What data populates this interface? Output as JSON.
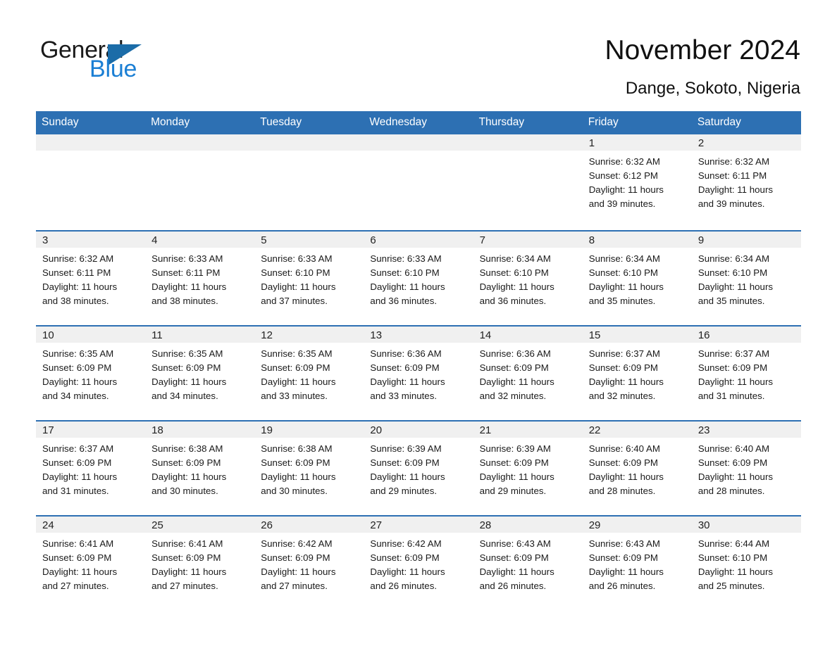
{
  "brand": {
    "name_part1": "General",
    "name_part2": "Blue",
    "triangle_color": "#1b6ca8",
    "blue_color": "#1b7fd4"
  },
  "header": {
    "title": "November 2024",
    "subtitle": "Dange, Sokoto, Nigeria"
  },
  "theme": {
    "header_bg": "#2d70b3",
    "header_text": "#ffffff",
    "daynum_bg": "#f0f0f0",
    "row_divider": "#2d70b3"
  },
  "weekdays": [
    "Sunday",
    "Monday",
    "Tuesday",
    "Wednesday",
    "Thursday",
    "Friday",
    "Saturday"
  ],
  "weeks": [
    [
      {
        "day": "",
        "sunrise": "",
        "sunset": "",
        "daylight_1": "",
        "daylight_2": ""
      },
      {
        "day": "",
        "sunrise": "",
        "sunset": "",
        "daylight_1": "",
        "daylight_2": ""
      },
      {
        "day": "",
        "sunrise": "",
        "sunset": "",
        "daylight_1": "",
        "daylight_2": ""
      },
      {
        "day": "",
        "sunrise": "",
        "sunset": "",
        "daylight_1": "",
        "daylight_2": ""
      },
      {
        "day": "",
        "sunrise": "",
        "sunset": "",
        "daylight_1": "",
        "daylight_2": ""
      },
      {
        "day": "1",
        "sunrise": "Sunrise: 6:32 AM",
        "sunset": "Sunset: 6:12 PM",
        "daylight_1": "Daylight: 11 hours",
        "daylight_2": "and 39 minutes."
      },
      {
        "day": "2",
        "sunrise": "Sunrise: 6:32 AM",
        "sunset": "Sunset: 6:11 PM",
        "daylight_1": "Daylight: 11 hours",
        "daylight_2": "and 39 minutes."
      }
    ],
    [
      {
        "day": "3",
        "sunrise": "Sunrise: 6:32 AM",
        "sunset": "Sunset: 6:11 PM",
        "daylight_1": "Daylight: 11 hours",
        "daylight_2": "and 38 minutes."
      },
      {
        "day": "4",
        "sunrise": "Sunrise: 6:33 AM",
        "sunset": "Sunset: 6:11 PM",
        "daylight_1": "Daylight: 11 hours",
        "daylight_2": "and 38 minutes."
      },
      {
        "day": "5",
        "sunrise": "Sunrise: 6:33 AM",
        "sunset": "Sunset: 6:10 PM",
        "daylight_1": "Daylight: 11 hours",
        "daylight_2": "and 37 minutes."
      },
      {
        "day": "6",
        "sunrise": "Sunrise: 6:33 AM",
        "sunset": "Sunset: 6:10 PM",
        "daylight_1": "Daylight: 11 hours",
        "daylight_2": "and 36 minutes."
      },
      {
        "day": "7",
        "sunrise": "Sunrise: 6:34 AM",
        "sunset": "Sunset: 6:10 PM",
        "daylight_1": "Daylight: 11 hours",
        "daylight_2": "and 36 minutes."
      },
      {
        "day": "8",
        "sunrise": "Sunrise: 6:34 AM",
        "sunset": "Sunset: 6:10 PM",
        "daylight_1": "Daylight: 11 hours",
        "daylight_2": "and 35 minutes."
      },
      {
        "day": "9",
        "sunrise": "Sunrise: 6:34 AM",
        "sunset": "Sunset: 6:10 PM",
        "daylight_1": "Daylight: 11 hours",
        "daylight_2": "and 35 minutes."
      }
    ],
    [
      {
        "day": "10",
        "sunrise": "Sunrise: 6:35 AM",
        "sunset": "Sunset: 6:09 PM",
        "daylight_1": "Daylight: 11 hours",
        "daylight_2": "and 34 minutes."
      },
      {
        "day": "11",
        "sunrise": "Sunrise: 6:35 AM",
        "sunset": "Sunset: 6:09 PM",
        "daylight_1": "Daylight: 11 hours",
        "daylight_2": "and 34 minutes."
      },
      {
        "day": "12",
        "sunrise": "Sunrise: 6:35 AM",
        "sunset": "Sunset: 6:09 PM",
        "daylight_1": "Daylight: 11 hours",
        "daylight_2": "and 33 minutes."
      },
      {
        "day": "13",
        "sunrise": "Sunrise: 6:36 AM",
        "sunset": "Sunset: 6:09 PM",
        "daylight_1": "Daylight: 11 hours",
        "daylight_2": "and 33 minutes."
      },
      {
        "day": "14",
        "sunrise": "Sunrise: 6:36 AM",
        "sunset": "Sunset: 6:09 PM",
        "daylight_1": "Daylight: 11 hours",
        "daylight_2": "and 32 minutes."
      },
      {
        "day": "15",
        "sunrise": "Sunrise: 6:37 AM",
        "sunset": "Sunset: 6:09 PM",
        "daylight_1": "Daylight: 11 hours",
        "daylight_2": "and 32 minutes."
      },
      {
        "day": "16",
        "sunrise": "Sunrise: 6:37 AM",
        "sunset": "Sunset: 6:09 PM",
        "daylight_1": "Daylight: 11 hours",
        "daylight_2": "and 31 minutes."
      }
    ],
    [
      {
        "day": "17",
        "sunrise": "Sunrise: 6:37 AM",
        "sunset": "Sunset: 6:09 PM",
        "daylight_1": "Daylight: 11 hours",
        "daylight_2": "and 31 minutes."
      },
      {
        "day": "18",
        "sunrise": "Sunrise: 6:38 AM",
        "sunset": "Sunset: 6:09 PM",
        "daylight_1": "Daylight: 11 hours",
        "daylight_2": "and 30 minutes."
      },
      {
        "day": "19",
        "sunrise": "Sunrise: 6:38 AM",
        "sunset": "Sunset: 6:09 PM",
        "daylight_1": "Daylight: 11 hours",
        "daylight_2": "and 30 minutes."
      },
      {
        "day": "20",
        "sunrise": "Sunrise: 6:39 AM",
        "sunset": "Sunset: 6:09 PM",
        "daylight_1": "Daylight: 11 hours",
        "daylight_2": "and 29 minutes."
      },
      {
        "day": "21",
        "sunrise": "Sunrise: 6:39 AM",
        "sunset": "Sunset: 6:09 PM",
        "daylight_1": "Daylight: 11 hours",
        "daylight_2": "and 29 minutes."
      },
      {
        "day": "22",
        "sunrise": "Sunrise: 6:40 AM",
        "sunset": "Sunset: 6:09 PM",
        "daylight_1": "Daylight: 11 hours",
        "daylight_2": "and 28 minutes."
      },
      {
        "day": "23",
        "sunrise": "Sunrise: 6:40 AM",
        "sunset": "Sunset: 6:09 PM",
        "daylight_1": "Daylight: 11 hours",
        "daylight_2": "and 28 minutes."
      }
    ],
    [
      {
        "day": "24",
        "sunrise": "Sunrise: 6:41 AM",
        "sunset": "Sunset: 6:09 PM",
        "daylight_1": "Daylight: 11 hours",
        "daylight_2": "and 27 minutes."
      },
      {
        "day": "25",
        "sunrise": "Sunrise: 6:41 AM",
        "sunset": "Sunset: 6:09 PM",
        "daylight_1": "Daylight: 11 hours",
        "daylight_2": "and 27 minutes."
      },
      {
        "day": "26",
        "sunrise": "Sunrise: 6:42 AM",
        "sunset": "Sunset: 6:09 PM",
        "daylight_1": "Daylight: 11 hours",
        "daylight_2": "and 27 minutes."
      },
      {
        "day": "27",
        "sunrise": "Sunrise: 6:42 AM",
        "sunset": "Sunset: 6:09 PM",
        "daylight_1": "Daylight: 11 hours",
        "daylight_2": "and 26 minutes."
      },
      {
        "day": "28",
        "sunrise": "Sunrise: 6:43 AM",
        "sunset": "Sunset: 6:09 PM",
        "daylight_1": "Daylight: 11 hours",
        "daylight_2": "and 26 minutes."
      },
      {
        "day": "29",
        "sunrise": "Sunrise: 6:43 AM",
        "sunset": "Sunset: 6:09 PM",
        "daylight_1": "Daylight: 11 hours",
        "daylight_2": "and 26 minutes."
      },
      {
        "day": "30",
        "sunrise": "Sunrise: 6:44 AM",
        "sunset": "Sunset: 6:10 PM",
        "daylight_1": "Daylight: 11 hours",
        "daylight_2": "and 25 minutes."
      }
    ]
  ]
}
